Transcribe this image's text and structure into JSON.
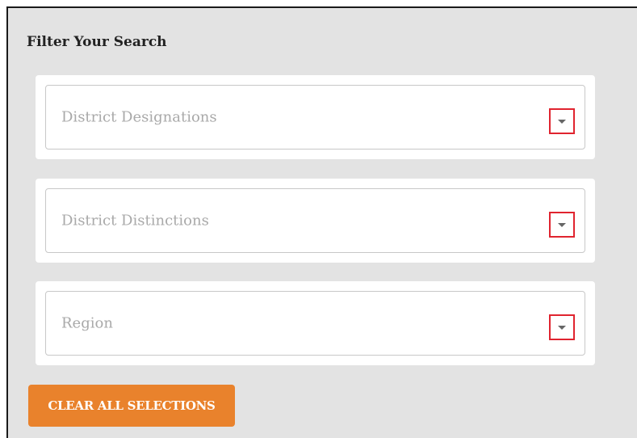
{
  "panel": {
    "title": "Filter Your Search"
  },
  "filters": [
    {
      "placeholder": "District Designations",
      "icon": "caret-down-icon"
    },
    {
      "placeholder": "District Distinctions",
      "icon": "caret-down-icon"
    },
    {
      "placeholder": "Region",
      "icon": "caret-down-icon"
    }
  ],
  "actions": {
    "clear_label": "CLEAR ALL SELECTIONS"
  },
  "colors": {
    "panel_background": "#e3e3e3",
    "card_background": "#ffffff",
    "placeholder_text": "#a9a9a9",
    "arrow_highlight_border": "#e0242f",
    "clear_button": "#e9822c",
    "clear_button_text": "#ffffff"
  }
}
